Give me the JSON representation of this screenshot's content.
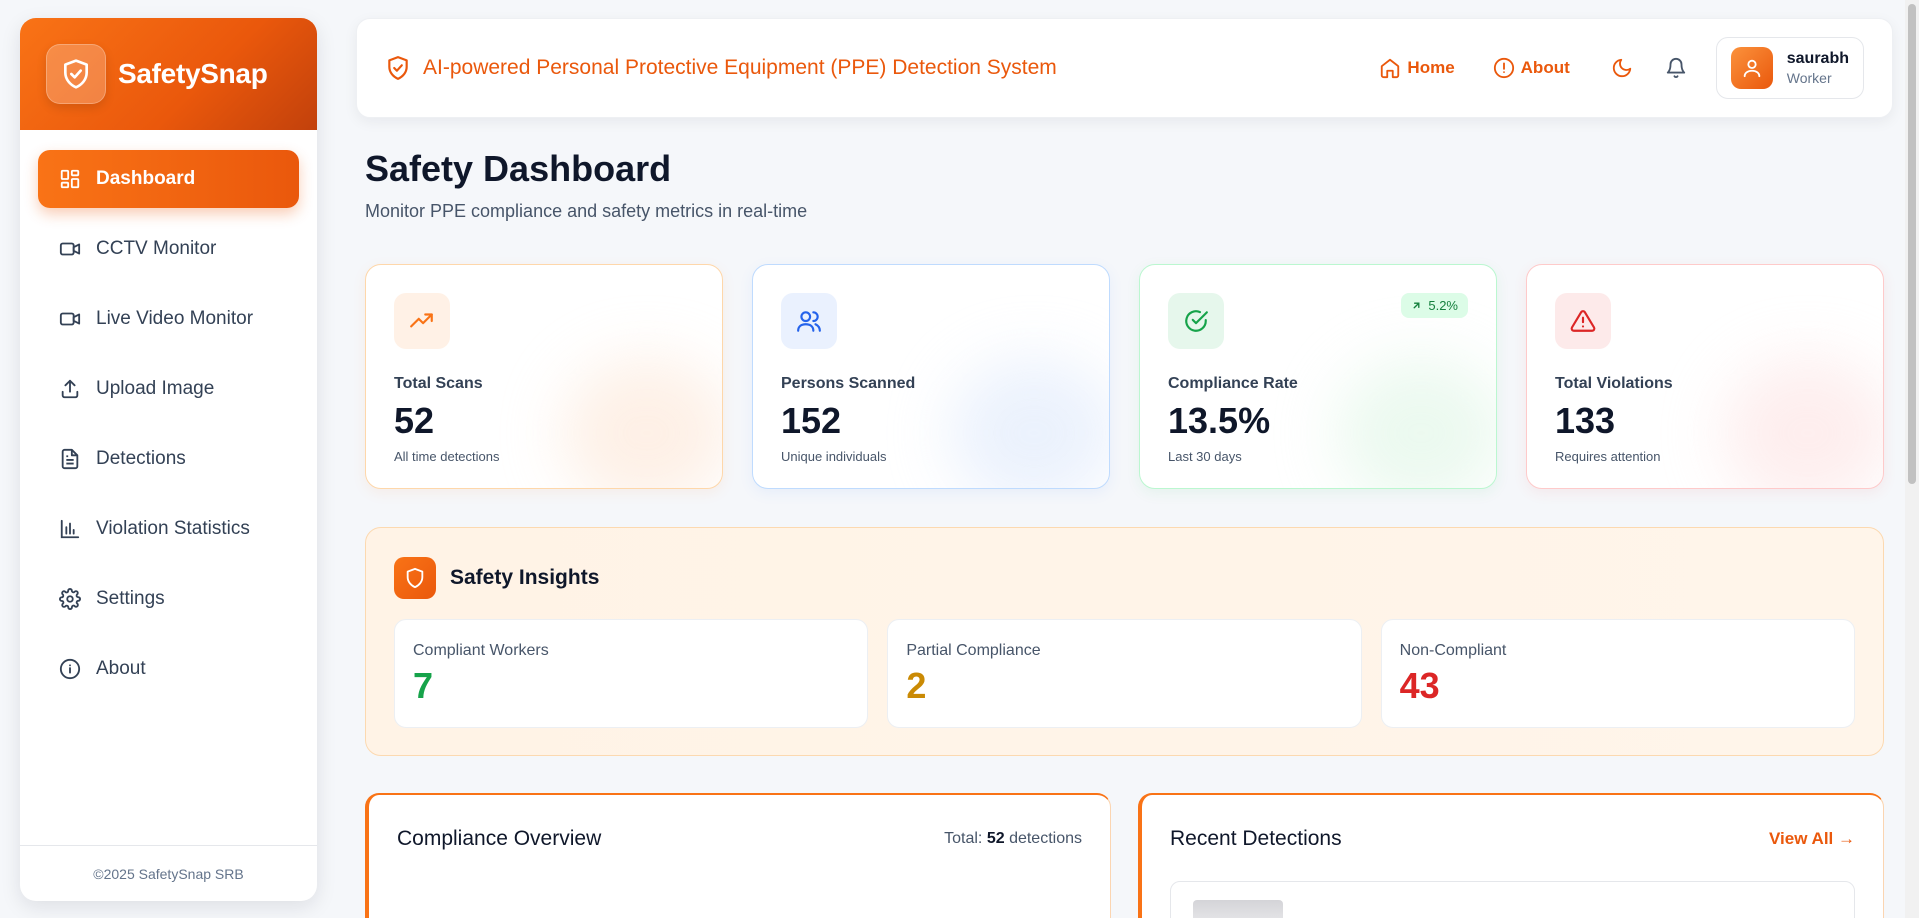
{
  "brand": {
    "name": "SafetySnap"
  },
  "nav": {
    "items": [
      {
        "label": "Dashboard",
        "icon": "dashboard-icon"
      },
      {
        "label": "CCTV Monitor",
        "icon": "video-camera-icon"
      },
      {
        "label": "Live Video Monitor",
        "icon": "video-camera-icon"
      },
      {
        "label": "Upload Image",
        "icon": "upload-icon"
      },
      {
        "label": "Detections",
        "icon": "document-icon"
      },
      {
        "label": "Violation Statistics",
        "icon": "bar-chart-icon"
      },
      {
        "label": "Settings",
        "icon": "gear-icon"
      },
      {
        "label": "About",
        "icon": "info-icon"
      }
    ],
    "active": "Dashboard"
  },
  "footer": {
    "text": "©2025 SafetySnap SRB"
  },
  "header": {
    "title": "AI-powered Personal Protective Equipment (PPE) Detection System",
    "links": {
      "home": "Home",
      "about": "About"
    },
    "user": {
      "name": "saurabh",
      "role": "Worker"
    }
  },
  "page": {
    "title": "Safety Dashboard",
    "subtitle": "Monitor PPE compliance and safety metrics in real-time"
  },
  "stats": [
    {
      "label": "Total Scans",
      "value": "52",
      "note": "All time detections",
      "icon": "trending-up-icon",
      "color": "#f97316"
    },
    {
      "label": "Persons Scanned",
      "value": "152",
      "note": "Unique individuals",
      "icon": "users-icon",
      "color": "#2563eb"
    },
    {
      "label": "Compliance Rate",
      "value": "13.5%",
      "note": "Last 30 days",
      "icon": "check-circle-icon",
      "color": "#16a34a",
      "trend": "5.2%"
    },
    {
      "label": "Total Violations",
      "value": "133",
      "note": "Requires attention",
      "icon": "warning-icon",
      "color": "#dc2626"
    }
  ],
  "insights": {
    "title": "Safety Insights",
    "cards": [
      {
        "label": "Compliant Workers",
        "value": "7",
        "color": "#16a34a"
      },
      {
        "label": "Partial Compliance",
        "value": "2",
        "color": "#ca8a04"
      },
      {
        "label": "Non-Compliant",
        "value": "43",
        "color": "#dc2626"
      }
    ]
  },
  "compliance": {
    "title": "Compliance Overview",
    "total_prefix": "Total:",
    "total_value": "52",
    "total_suffix": "detections"
  },
  "recent": {
    "title": "Recent Detections",
    "view_all": "View All →"
  },
  "colors": {
    "accent": "#ea580c",
    "accent_light": "#f97316"
  }
}
